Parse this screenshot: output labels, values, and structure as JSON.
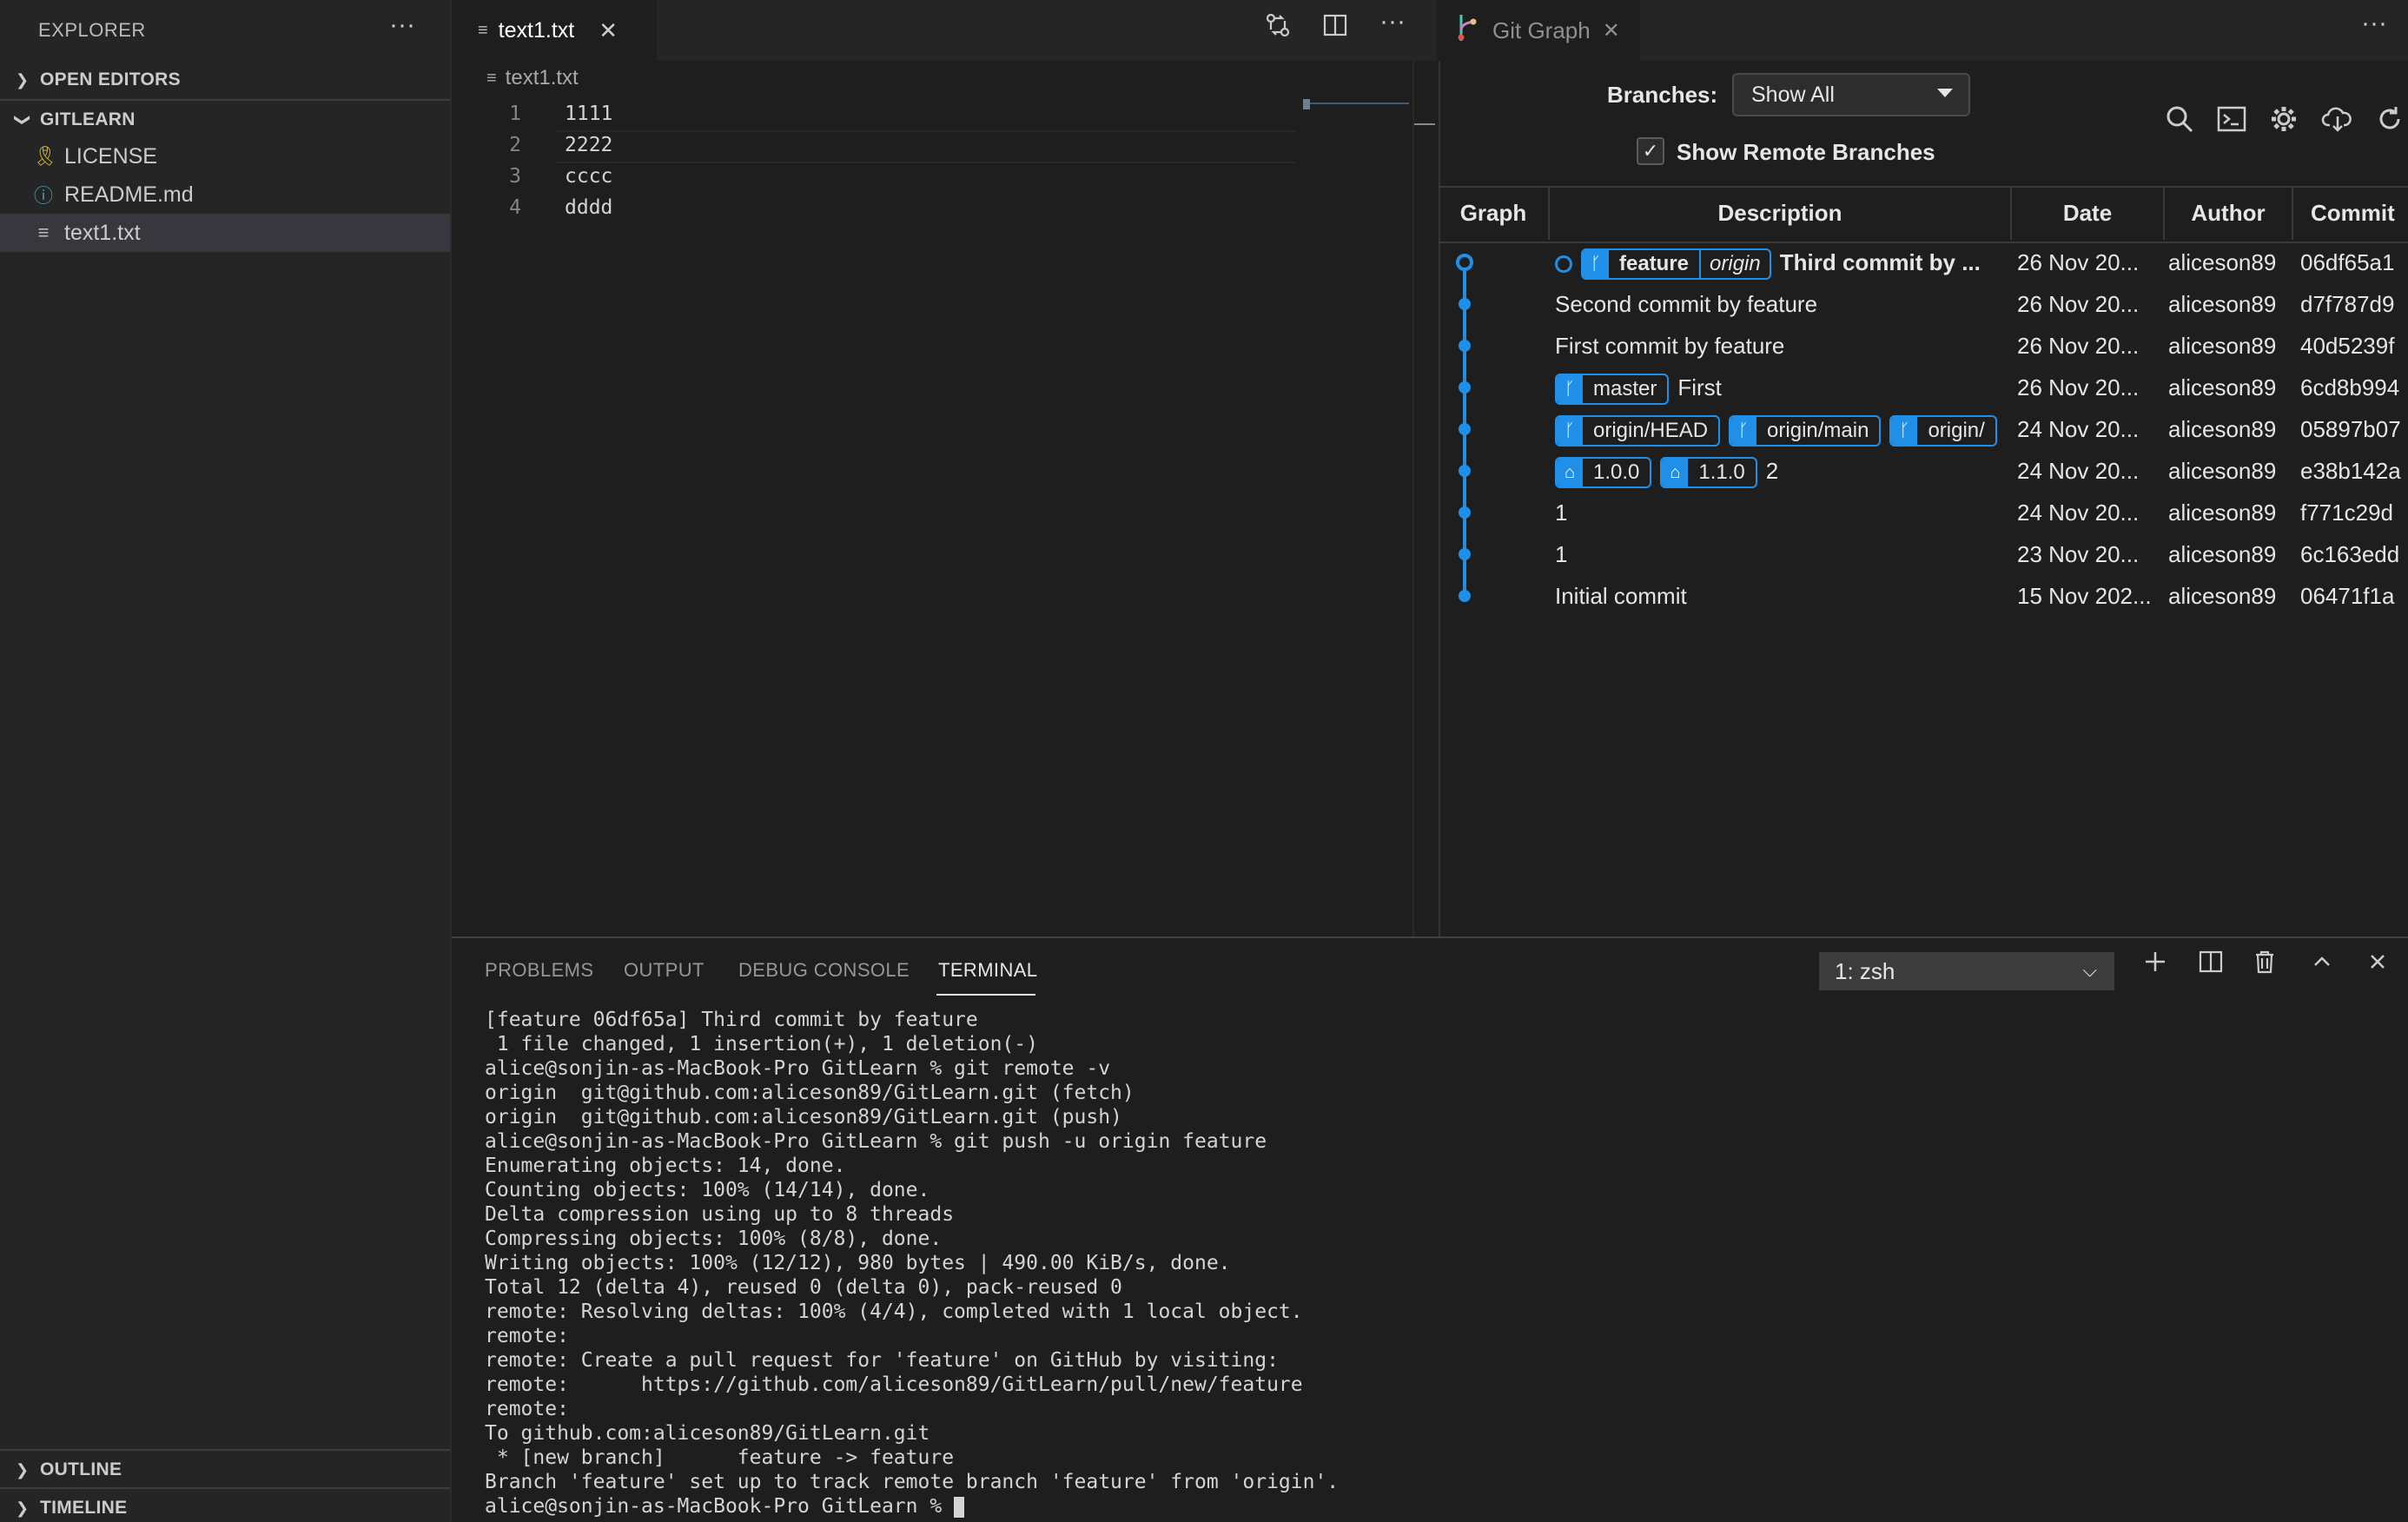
{
  "explorer": {
    "title": "EXPLORER",
    "more": "···",
    "open_editors": "OPEN EDITORS",
    "folder": "GITLEARN",
    "files": [
      {
        "name": "LICENSE",
        "icon": "license-icon"
      },
      {
        "name": "README.md",
        "icon": "info-icon"
      },
      {
        "name": "text1.txt",
        "icon": "text-file-icon"
      }
    ],
    "outline": "OUTLINE",
    "timeline": "TIMELINE"
  },
  "editor": {
    "tab_label": "text1.txt",
    "breadcrumb": "text1.txt",
    "lines": [
      {
        "num": "1",
        "text": "1111"
      },
      {
        "num": "2",
        "text": "2222"
      },
      {
        "num": "3",
        "text": "cccc"
      },
      {
        "num": "4",
        "text": "dddd"
      }
    ]
  },
  "gitgraph": {
    "tab_label": "Git Graph",
    "branches_label": "Branches:",
    "branches_value": "Show All",
    "show_remote_label": "Show Remote Branches",
    "show_remote_checked": true,
    "columns": [
      "Graph",
      "Description",
      "Date",
      "Author",
      "Commit"
    ],
    "accent": "#1f8fe8",
    "commits": [
      {
        "refs": [
          {
            "name": "feature",
            "origin": "origin",
            "type": "branch"
          }
        ],
        "message": "Third commit by ...",
        "bold": true,
        "date": "26 Nov 20...",
        "author": "aliceson89",
        "hash": "06df65a1"
      },
      {
        "refs": [],
        "message": "Second commit by feature",
        "date": "26 Nov 20...",
        "author": "aliceson89",
        "hash": "d7f787d9"
      },
      {
        "refs": [],
        "message": "First commit by feature",
        "date": "26 Nov 20...",
        "author": "aliceson89",
        "hash": "40d5239f"
      },
      {
        "refs": [
          {
            "name": "master",
            "type": "branch"
          }
        ],
        "message": "First",
        "date": "26 Nov 20...",
        "author": "aliceson89",
        "hash": "6cd8b994"
      },
      {
        "refs": [
          {
            "name": "origin/HEAD",
            "type": "branch"
          },
          {
            "name": "origin/main",
            "type": "branch"
          },
          {
            "name": "origin/",
            "type": "branch"
          }
        ],
        "message": "",
        "date": "24 Nov 20...",
        "author": "aliceson89",
        "hash": "05897b07"
      },
      {
        "refs": [
          {
            "name": "1.0.0",
            "type": "tag"
          },
          {
            "name": "1.1.0",
            "type": "tag"
          }
        ],
        "message": "2",
        "date": "24 Nov 20...",
        "author": "aliceson89",
        "hash": "e38b142a"
      },
      {
        "refs": [],
        "message": "1",
        "date": "24 Nov 20...",
        "author": "aliceson89",
        "hash": "f771c29d"
      },
      {
        "refs": [],
        "message": "1",
        "date": "23 Nov 20...",
        "author": "aliceson89",
        "hash": "6c163edd"
      },
      {
        "refs": [],
        "message": "Initial commit",
        "date": "15 Nov 202...",
        "author": "aliceson89",
        "hash": "06471f1a"
      }
    ]
  },
  "panel": {
    "tabs": [
      "PROBLEMS",
      "OUTPUT",
      "DEBUG CONSOLE",
      "TERMINAL"
    ],
    "active_tab": "TERMINAL",
    "terminal_select": "1: zsh",
    "terminal_lines": [
      "[feature 06df65a] Third commit by feature",
      " 1 file changed, 1 insertion(+), 1 deletion(-)",
      "alice@sonjin-as-MacBook-Pro GitLearn % git remote -v",
      "origin  git@github.com:aliceson89/GitLearn.git (fetch)",
      "origin  git@github.com:aliceson89/GitLearn.git (push)",
      "alice@sonjin-as-MacBook-Pro GitLearn % git push -u origin feature",
      "Enumerating objects: 14, done.",
      "Counting objects: 100% (14/14), done.",
      "Delta compression using up to 8 threads",
      "Compressing objects: 100% (8/8), done.",
      "Writing objects: 100% (12/12), 980 bytes | 490.00 KiB/s, done.",
      "Total 12 (delta 4), reused 0 (delta 0), pack-reused 0",
      "remote: Resolving deltas: 100% (4/4), completed with 1 local object.",
      "remote:",
      "remote: Create a pull request for 'feature' on GitHub by visiting:",
      "remote:      https://github.com/aliceson89/GitLearn/pull/new/feature",
      "remote:",
      "To github.com:aliceson89/GitLearn.git",
      " * [new branch]      feature -> feature",
      "Branch 'feature' set up to track remote branch 'feature' from 'origin'.",
      "alice@sonjin-as-MacBook-Pro GitLearn % "
    ]
  }
}
